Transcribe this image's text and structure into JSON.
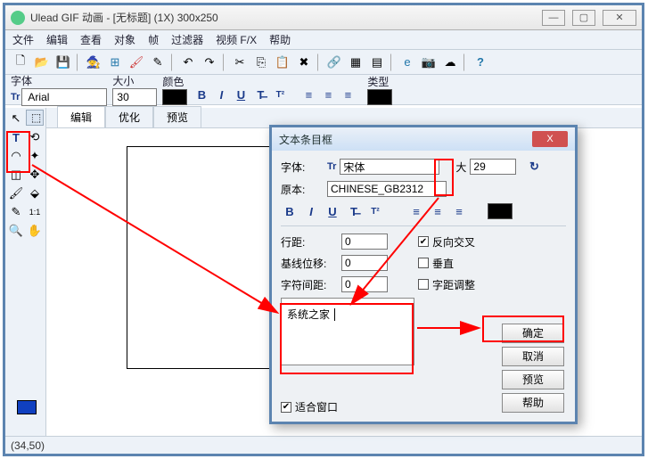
{
  "window": {
    "title": "Ulead GIF 动画 - [无标题] (1X) 300x250",
    "min": "—",
    "max": "▢",
    "close": "✕"
  },
  "menus": [
    "文件",
    "编辑",
    "查看",
    "对象",
    "帧",
    "过滤器",
    "视频 F/X",
    "帮助"
  ],
  "fontbar": {
    "font_label": "字体",
    "font_value": "Arial",
    "size_label": "大小",
    "size_value": "30",
    "color_label": "颜色",
    "type_label": "类型"
  },
  "tabs": {
    "edit": "编辑",
    "optimize": "优化",
    "preview": "预览"
  },
  "status": "(34,50)",
  "dialog": {
    "title": "文本条目框",
    "close": "X",
    "font_label": "字体:",
    "font_value": "宋体",
    "size_label": "大",
    "size_value": "29",
    "charset_label": "原本:",
    "charset_value": "CHINESE_GB2312",
    "line_spacing_label": "行距:",
    "line_spacing_value": "0",
    "baseline_label": "基线位移:",
    "baseline_value": "0",
    "kerning_label": "字符间距:",
    "kerning_value": "0",
    "reverse_label": "反向交叉",
    "vertical_label": "垂直",
    "kern_adj_label": "字距调整",
    "text_value": "系统之家",
    "ok": "确定",
    "cancel": "取消",
    "preview": "预览",
    "help": "帮助",
    "fit_window": "适合窗口"
  }
}
